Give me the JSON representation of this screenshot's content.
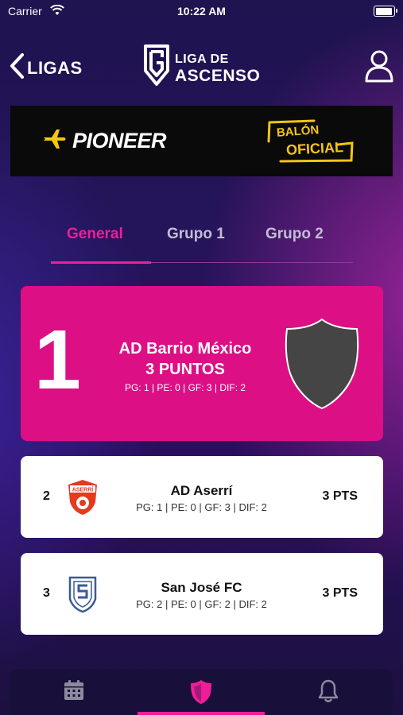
{
  "status_bar": {
    "carrier": "Carrier",
    "time": "10:22 AM"
  },
  "header": {
    "back_label": "LIGAS",
    "logo_line1": "LIGA DE",
    "logo_line2": "ASCENSO"
  },
  "banner": {
    "sponsor": "PIONEER",
    "tagline_line1": "BALÓN",
    "tagline_line2": "OFICIAL"
  },
  "tabs": [
    {
      "label": "General",
      "active": true
    },
    {
      "label": "Grupo 1",
      "active": false
    },
    {
      "label": "Grupo 2",
      "active": false
    }
  ],
  "leader": {
    "rank": "1",
    "team": "AD Barrio México",
    "points": "3 PUNTOS",
    "stats": "PG: 1 | PE: 0 | GF: 3 | DIF: 2"
  },
  "standings": [
    {
      "rank": "2",
      "team": "AD Aserrí",
      "stats": "PG: 1 | PE: 0 | GF: 3 | DIF: 2",
      "points": "3 PTS",
      "badge_text": "ASERRÍ"
    },
    {
      "rank": "3",
      "team": "San José FC",
      "stats": "PG: 2 | PE: 0 | GF: 2 | DIF: 2",
      "points": "3 PTS"
    }
  ],
  "tab_bar": [
    {
      "icon": "calendar-icon",
      "active": false
    },
    {
      "icon": "shield-icon",
      "active": true
    },
    {
      "icon": "bell-icon",
      "active": false
    }
  ],
  "colors": {
    "accent": "#ef1e98",
    "leader_card": "#dd0f85",
    "banner_gold": "#f5c514"
  }
}
